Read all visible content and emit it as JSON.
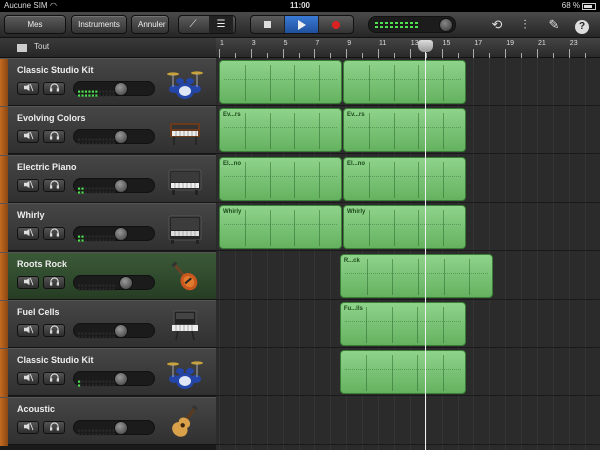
{
  "status_bar": {
    "carrier": "Aucune SIM",
    "time": "11:00",
    "battery": "68 %"
  },
  "toolbar": {
    "songs_label": "Mes morceaux",
    "instruments_label": "Instruments",
    "undo_label": "Annuler"
  },
  "ruler": {
    "all_label": "Tout",
    "bars": [
      "1",
      "3",
      "5",
      "7",
      "9",
      "11",
      "13",
      "15",
      "17",
      "19",
      "21",
      "23"
    ]
  },
  "tracks": [
    {
      "name": "Classic Studio Kit",
      "instrument_icon": "drum-kit-icon",
      "meter_level": 0.55,
      "volume": 0.6
    },
    {
      "name": "Evolving Colors",
      "instrument_icon": "synth-icon",
      "meter_level": 0.0,
      "volume": 0.6
    },
    {
      "name": "Electric Piano",
      "instrument_icon": "electric-piano-icon",
      "meter_level": 0.2,
      "volume": 0.6
    },
    {
      "name": "Whirly",
      "instrument_icon": "organ-icon",
      "meter_level": 0.15,
      "volume": 0.6
    },
    {
      "name": "Roots Rock",
      "instrument_icon": "guitar-icon",
      "meter_level": 0.0,
      "volume": 0.68
    },
    {
      "name": "Fuel Cells",
      "instrument_icon": "keyboard-icon",
      "meter_level": 0.0,
      "volume": 0.6
    },
    {
      "name": "Classic Studio Kit",
      "instrument_icon": "drum-kit-icon",
      "meter_level": 0.1,
      "volume": 0.6
    },
    {
      "name": "Acoustic",
      "instrument_icon": "acoustic-guitar-icon",
      "meter_level": 0.0,
      "volume": 0.6
    }
  ],
  "regions": [
    {
      "label": "",
      "lane": 0,
      "start_bar": 1,
      "end_bar": 8.8
    },
    {
      "label": "",
      "lane": 0,
      "start_bar": 8.8,
      "end_bar": 16.6
    },
    {
      "label": "Ev...rs",
      "lane": 1,
      "start_bar": 1,
      "end_bar": 8.8
    },
    {
      "label": "Ev...rs",
      "lane": 1,
      "start_bar": 8.8,
      "end_bar": 16.6
    },
    {
      "label": "El...no",
      "lane": 2,
      "start_bar": 1,
      "end_bar": 8.8
    },
    {
      "label": "El...no",
      "lane": 2,
      "start_bar": 8.8,
      "end_bar": 16.6
    },
    {
      "label": "Whirly",
      "lane": 3,
      "start_bar": 1,
      "end_bar": 8.8
    },
    {
      "label": "Whirly",
      "lane": 3,
      "start_bar": 8.8,
      "end_bar": 16.6
    },
    {
      "label": "R...ck",
      "lane": 4,
      "start_bar": 8.6,
      "end_bar": 18.3
    },
    {
      "label": "Fu...lls",
      "lane": 5,
      "start_bar": 8.6,
      "end_bar": 16.6
    },
    {
      "label": "",
      "lane": 6,
      "start_bar": 8.6,
      "end_bar": 16.6
    }
  ],
  "playhead_bar": 14.2,
  "colors": {
    "region": "#7cc878",
    "selected_track": "#2f4a2c",
    "accent": "#2f6cc4"
  }
}
